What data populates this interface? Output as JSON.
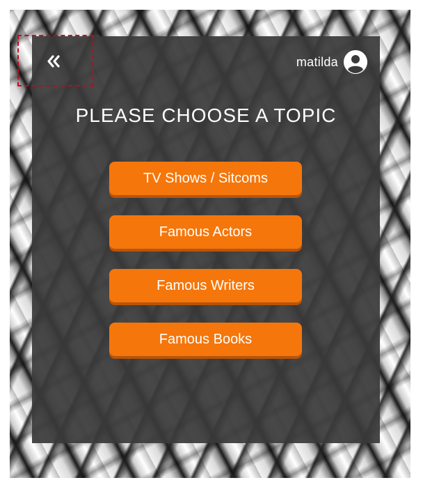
{
  "header": {
    "username": "matilda",
    "back_icon": "double-chevron-left-icon",
    "avatar_icon": "user-circle-icon"
  },
  "main": {
    "title": "PLEASE CHOOSE A TOPIC",
    "topics": [
      {
        "label": "TV Shows / Sitcoms"
      },
      {
        "label": "Famous Actors"
      },
      {
        "label": "Famous Writers"
      },
      {
        "label": "Famous Books"
      }
    ]
  },
  "colors": {
    "accent": "#f5760b",
    "panel": "#3a3a3a",
    "highlight": "#d0021b"
  }
}
